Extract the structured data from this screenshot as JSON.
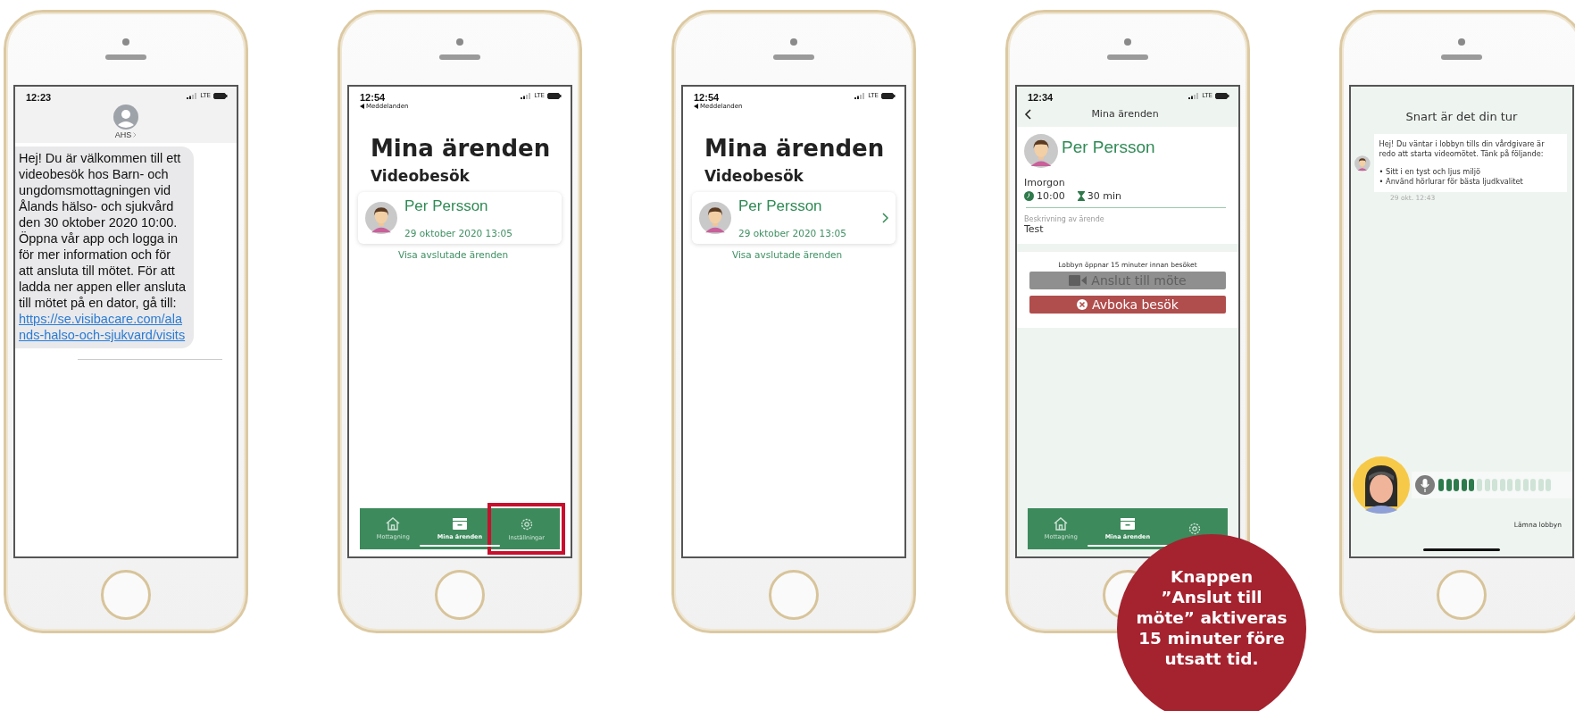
{
  "phones": [
    {
      "kind": "sms",
      "time": "12:23",
      "network": "LTE",
      "contact": "AHS",
      "message": "Hej! Du är välkommen till ett videobesök hos Barn- och ungdomsmottagningen vid Ålands hälso- och sjukvård den 30 oktober 2020 10:00. Öppna vår app och logga in för mer information och för att ansluta till mötet. För att ladda ner appen eller ansluta till mötet på en dator, gå till:",
      "link": "https://se.visibacare.com/alands-halso-och-sjukvard/visits"
    },
    {
      "kind": "case_list",
      "time": "12:54",
      "back": "Meddelanden",
      "network": "LTE",
      "title": "Mina ärenden",
      "section": "Videobesök",
      "cases": [
        {
          "name": "Per Persson",
          "date": "29 oktober 2020 13:05",
          "chevron": false
        }
      ],
      "history_link": "Visa avslutade ärenden",
      "tabs": [
        {
          "kind": "home",
          "label": "Mottagning",
          "selected": false,
          "highlighted": false
        },
        {
          "kind": "inbox",
          "label": "Mina ärenden",
          "selected": true,
          "highlighted": false
        },
        {
          "kind": "gear",
          "label": "Inställningar",
          "selected": false,
          "highlighted": true
        }
      ]
    },
    {
      "kind": "case_list",
      "time": "12:54",
      "back": "Meddelanden",
      "network": "LTE",
      "title": "Mina ärenden",
      "section": "Videobesök",
      "cases": [
        {
          "name": "Per Persson",
          "date": "29 oktober 2020 13:05",
          "chevron": true
        }
      ],
      "history_link": "Visa avslutade ärenden"
    },
    {
      "kind": "case_detail",
      "time": "12:34",
      "network": "LTE",
      "nav_title": "Mina ärenden",
      "name": "Per Persson",
      "day": "Imorgon",
      "time_of_day": "10:00",
      "duration": "30 min",
      "description_label": "Beskrivning av ärende",
      "description": "Test",
      "lobby_note": "Lobbyn öppnar 15 minuter innan besöket",
      "buttons": [
        {
          "kind": "join",
          "label": "Anslut till möte",
          "disabled": true
        },
        {
          "kind": "cancel",
          "label": "Avboka besök",
          "disabled": false
        }
      ],
      "tabs": [
        {
          "kind": "home",
          "label": "Mottagning",
          "selected": false,
          "highlighted": false
        },
        {
          "kind": "inbox",
          "label": "Mina ärenden",
          "selected": true,
          "highlighted": false
        },
        {
          "kind": "gear",
          "selected": false,
          "highlighted": false
        }
      ]
    },
    {
      "kind": "lobby",
      "title": "Snart är det din tur",
      "message": "Hej! Du väntar i lobbyn tills din vårdgivare är redo att starta videomötet. Tänk på följande:",
      "bullets": [
        "• Sitt i en tyst och ljus miljö",
        "• Använd hörlurar för bästa ljudkvalitet"
      ],
      "timestamp": "29 okt. 12:43",
      "mic": {
        "level": 0.33
      },
      "leave": "Lämna lobbyn"
    }
  ],
  "callout": {
    "text": "Knappen ”Anslut till möte” aktiveras 15 minuter före utsatt tid."
  }
}
